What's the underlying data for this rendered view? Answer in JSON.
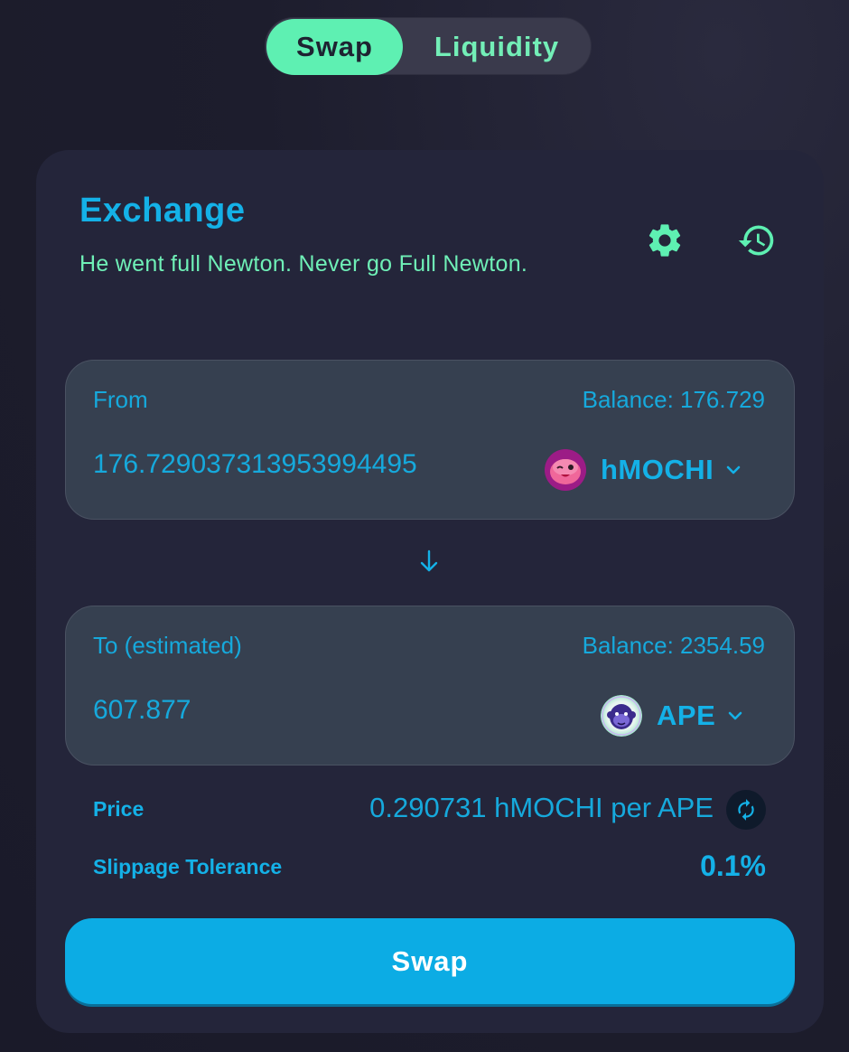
{
  "mode_toggle": {
    "swap_label": "Swap",
    "liquidity_label": "Liquidity",
    "active": "Swap"
  },
  "exchange": {
    "title": "Exchange",
    "subtitle": "He went full Newton. Never go Full Newton.",
    "settings_icon": "gear-icon",
    "history_icon": "history-icon"
  },
  "from": {
    "label": "From",
    "balance": "Balance: 176.729",
    "amount": "176.729037313953994495",
    "token": "hMOCHI",
    "token_icon": "hmochi-token-icon"
  },
  "to": {
    "label": "To (estimated)",
    "balance": "Balance: 2354.59",
    "amount": "607.877",
    "token": "APE",
    "token_icon": "ape-token-icon"
  },
  "price": {
    "label": "Price",
    "value": "0.290731 hMOCHI per APE"
  },
  "slippage": {
    "label": "Slippage Tolerance",
    "value": "0.1%"
  },
  "swap_button": "Swap",
  "colors": {
    "accent_green": "#5ef0b2",
    "accent_blue": "#14b1e7",
    "card_bg": "#24253a",
    "panel_bg": "#364050",
    "button_bg": "#0cace4"
  }
}
